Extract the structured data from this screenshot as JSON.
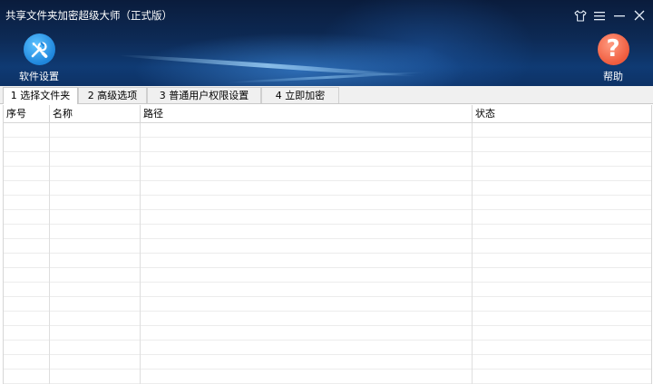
{
  "window": {
    "title": "共享文件夹加密超级大师（正式版）",
    "controls": [
      "skin-icon",
      "menu-icon",
      "minimize-icon",
      "close-icon"
    ]
  },
  "toolbar": {
    "settings_label": "软件设置",
    "settings_icon": "wrench-screwdriver-icon",
    "help_label": "帮助",
    "help_icon": "question-mark-icon",
    "help_glyph": "?"
  },
  "tabs": [
    {
      "label": "1 选择文件夹",
      "active": true
    },
    {
      "label": "2 高级选项",
      "active": false
    },
    {
      "label": "3 普通用户权限设置",
      "active": false
    },
    {
      "label": "4 立即加密",
      "active": false
    }
  ],
  "table": {
    "columns": [
      "序号",
      "名称",
      "路径",
      "状态"
    ],
    "rows": []
  },
  "colors": {
    "header_bg": "#0d2a55",
    "settings_icon": "#1e86dc",
    "help_icon": "#ef5b3d"
  }
}
